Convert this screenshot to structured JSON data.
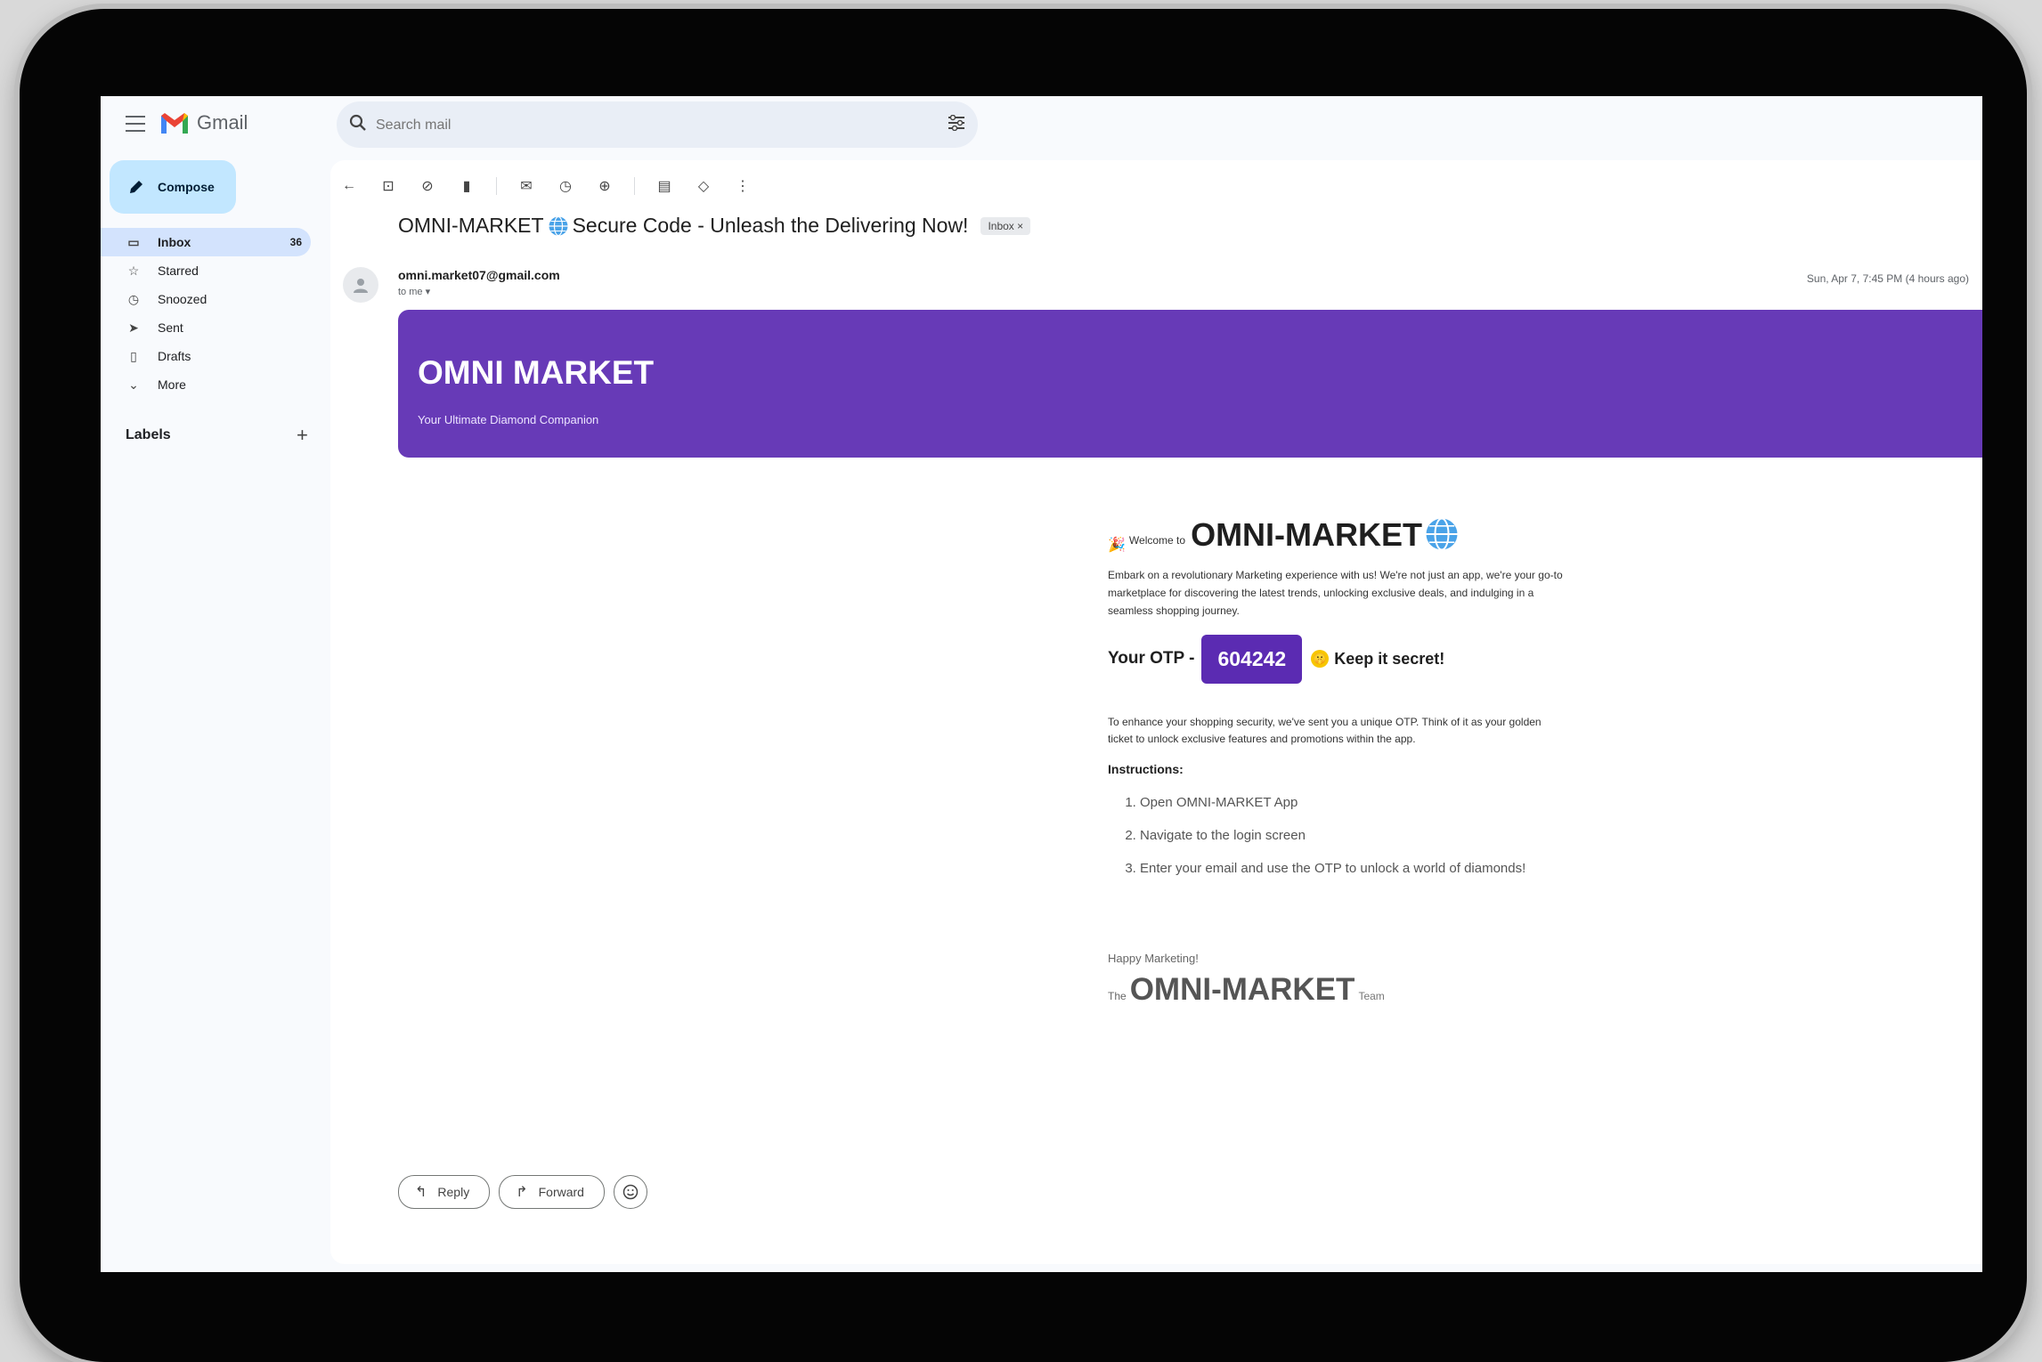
{
  "app": {
    "name": "Gmail"
  },
  "search": {
    "placeholder": "Search mail"
  },
  "sidebar": {
    "compose_label": "Compose",
    "items": [
      {
        "label": "Inbox",
        "count": "36",
        "icon": "inbox-icon"
      },
      {
        "label": "Starred",
        "icon": "star-icon"
      },
      {
        "label": "Snoozed",
        "icon": "clock-icon"
      },
      {
        "label": "Sent",
        "icon": "send-icon"
      },
      {
        "label": "Drafts",
        "icon": "draft-icon"
      },
      {
        "label": "More",
        "icon": "chevron-down-icon"
      }
    ],
    "labels_heading": "Labels",
    "labels_add": "+"
  },
  "message": {
    "subject_before": "OMNI-MARKET",
    "subject_after": "Secure Code - Unleash the Delivering Now!",
    "inbox_chip": "Inbox ×",
    "sender": "omni.market07@gmail.com",
    "to": "to me ▾",
    "date": "Sun, Apr 7, 7:45 PM (4 hours ago)"
  },
  "email": {
    "banner_title": "OMNI MARKET",
    "banner_subtitle": "Your Ultimate Diamond Companion",
    "welcome_small": "Welcome to",
    "welcome_brand": "OMNI-MARKET",
    "intro": "Embark on a revolutionary Marketing experience with us! We're not just an app, we're your go-to marketplace for discovering the latest trends, unlocking exclusive deals, and indulging in a seamless shopping journey.",
    "otp_label": "Your OTP -",
    "otp_code": "604242",
    "otp_note": "Keep it secret!",
    "security": "To enhance your shopping security, we've sent you a unique OTP. Think of it as your golden ticket to unlock exclusive features and promotions within the app.",
    "instructions_heading": "Instructions:",
    "steps": [
      "Open OMNI-MARKET App",
      "Navigate to the login screen",
      "Enter your email and use the OTP to unlock a world of diamonds!"
    ],
    "happy": "Happy Marketing!",
    "sign_small": "The",
    "sign_brand": "OMNI-MARKET",
    "sign_team": "Team"
  },
  "actions": {
    "reply": "Reply",
    "forward": "Forward"
  },
  "colors": {
    "banner": "#673ab7",
    "otp": "#5b2bb2",
    "compose": "#c2e7ff",
    "active_nav": "#d3e3fd"
  }
}
